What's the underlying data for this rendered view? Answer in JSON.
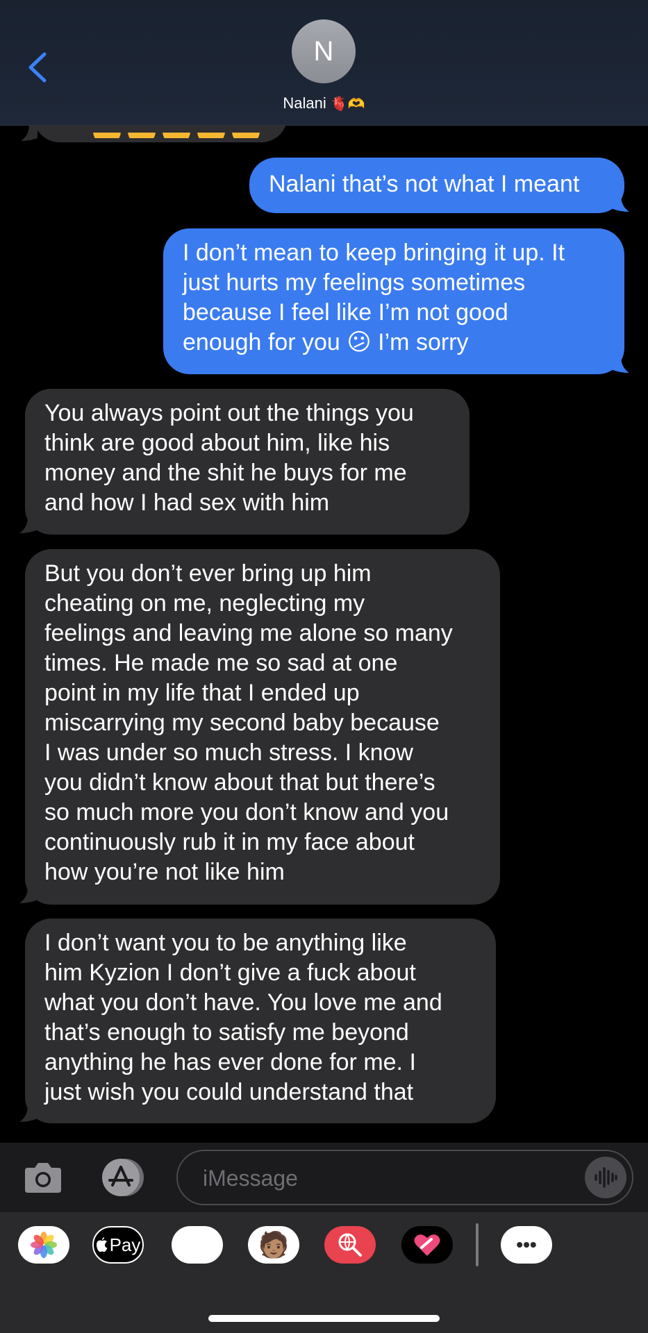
{
  "header": {
    "avatar_initial": "N",
    "contact_name": "Nalani",
    "contact_emoji": "🫀🫶"
  },
  "messages": [
    {
      "direction": "in",
      "text": ""
    },
    {
      "direction": "out",
      "text": "Nalani that’s not what I meant"
    },
    {
      "direction": "out",
      "lines": [
        "I don’t mean to keep bringing it up. It",
        "just hurts my feelings sometimes",
        "because I feel like I’m not good",
        "enough for you 😕 I’m sorry"
      ]
    },
    {
      "direction": "in",
      "lines": [
        "You always point out the things you",
        "think are good about him, like his",
        "money and the shit he buys for me",
        "and how I had sex with him"
      ]
    },
    {
      "direction": "in",
      "lines": [
        "But you don’t ever bring up him",
        "cheating on me, neglecting my",
        "feelings and leaving me alone so many",
        "times. He made me so sad at one",
        "point in my life that I ended up",
        "miscarrying my second baby because",
        "I was under so much stress. I know",
        "you didn’t know about that but there’s",
        "so much more you don’t know and you",
        "continuously rub it in my face about",
        "how you’re not like him"
      ]
    },
    {
      "direction": "in",
      "lines": [
        "I don’t want you to be anything like",
        "him Kyzion I don’t give a fuck about",
        "what you don’t have. You love me and",
        "that’s enough to satisfy me beyond",
        "anything he has ever done for me. I",
        "just wish you could understand that"
      ]
    }
  ],
  "compose": {
    "placeholder": "iMessage"
  },
  "app_drawer": {
    "items": [
      {
        "name": "photos-app-icon",
        "label": ""
      },
      {
        "name": "apple-pay-app-icon",
        "label": "Pay"
      },
      {
        "name": "animoji-app-icon",
        "label": "🐵"
      },
      {
        "name": "memoji-app-icon",
        "label": "🧑🏽"
      },
      {
        "name": "images-search-app-icon",
        "label": ""
      },
      {
        "name": "digital-touch-app-icon",
        "label": ""
      },
      {
        "name": "more-apps-icon",
        "label": "•••"
      }
    ]
  }
}
